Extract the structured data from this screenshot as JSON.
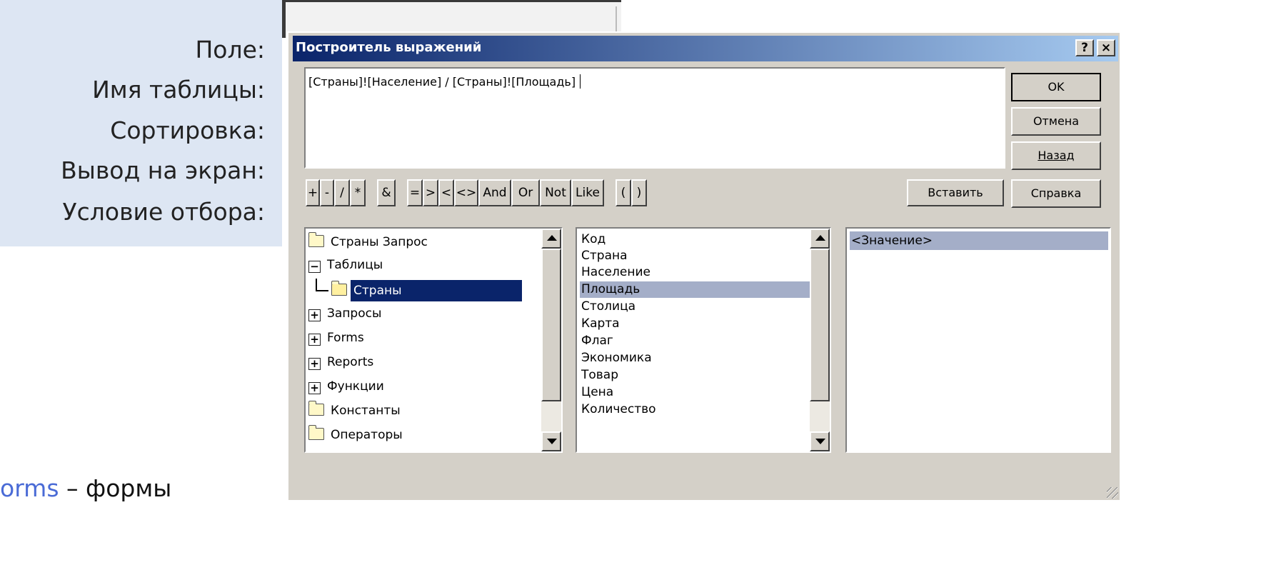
{
  "background": {
    "grid_labels": [
      "Поле:",
      "Имя таблицы:",
      "Сортировка:",
      "Вывод на экран:",
      "Условие отбора:"
    ],
    "caption_link": "orms",
    "caption_rest": " – формы"
  },
  "dialog": {
    "title": "Построитель выражений",
    "help_button": "?",
    "close_button": "×",
    "expression": "[Страны]![Население] / [Страны]![Площадь]",
    "buttons": {
      "ok": "OK",
      "cancel": "Отмена",
      "back": "Назад",
      "help": "Справка",
      "insert": "Вставить"
    },
    "operators": [
      "+",
      "-",
      "/",
      "*",
      "&",
      "=",
      ">",
      "<",
      "<>",
      "And",
      "Or",
      "Not",
      "Like",
      "(",
      ")"
    ],
    "tree": [
      {
        "label": "Страны Запрос",
        "icon": "folder-icon"
      },
      {
        "label": "Таблицы",
        "icon": "collapse-icon"
      },
      {
        "label": "Страны",
        "icon": "open-folder-icon",
        "selected": true
      },
      {
        "label": "Запросы",
        "icon": "expand-icon"
      },
      {
        "label": "Forms",
        "icon": "expand-icon"
      },
      {
        "label": "Reports",
        "icon": "expand-icon"
      },
      {
        "label": "Функции",
        "icon": "expand-icon"
      },
      {
        "label": "Константы",
        "icon": "folder-icon"
      },
      {
        "label": "Операторы",
        "icon": "folder-icon"
      }
    ],
    "fields": [
      "Код",
      "Страна",
      "Население",
      "Площадь",
      "Столица",
      "Карта",
      "Флаг",
      "Экономика",
      "Товар",
      "Цена",
      "Количество"
    ],
    "selected_field": "Площадь",
    "values": [
      "<Значение>"
    ],
    "colors": {
      "title_start": "#0a246a",
      "title_end": "#a6caf0",
      "face": "#d4d0c8",
      "selection": "#0a246a",
      "inactive_selection": "#a4aec8"
    }
  }
}
